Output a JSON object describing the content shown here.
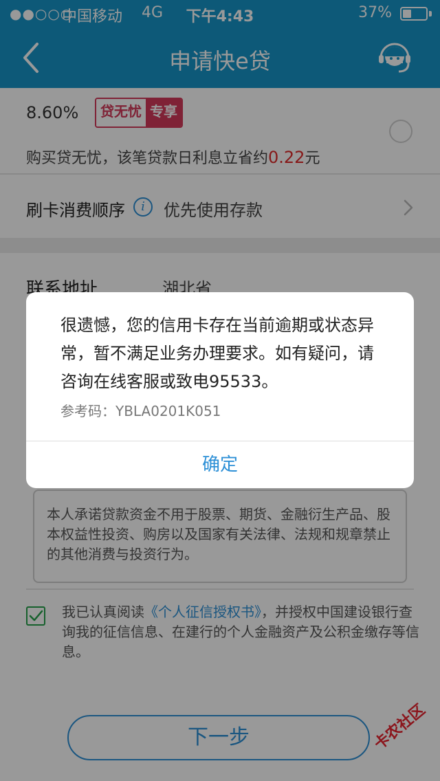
{
  "status_bar": {
    "signal": "●●○○○",
    "carrier": "中国移动",
    "network": "4G",
    "time": "下午4:43",
    "battery_percent": "37%",
    "battery_level": 0.37
  },
  "nav": {
    "title": "申请快e贷",
    "back_icon": "chevron-left-icon",
    "service_icon": "customer-service-icon"
  },
  "rate_option": {
    "rate": "8.60%",
    "badge_left": "贷无忧",
    "badge_right": "专享",
    "discount_prefix": "购买贷无忧，该笔贷款日利息立省约",
    "discount_amount": "0.22",
    "discount_suffix": "元"
  },
  "card_order": {
    "label": "刷卡消费顺序",
    "value": "优先使用存款"
  },
  "address": {
    "label": "联系地址",
    "value": "湖北省"
  },
  "commitment": "本人承诺贷款资金不用于股票、期货、金融衍生产品、股本权益性投资、购房以及国家有关法律、法规和规章禁止的其他消费与投资行为。",
  "agreement": {
    "prefix": "我已认真阅读",
    "link": "《个人征信授权书》",
    "suffix": "，并授权中国建设银行查询我的征信信息、在建行的个人金融资产及公积金缴存等信息。",
    "checked": true
  },
  "next_button": "下一步",
  "watermark": "卡农社区",
  "dialog": {
    "message": "很遗憾，您的信用卡存在当前逾期或状态异常，暂不满足业务办理要求。如有疑问，请咨询在线客服或致电95533。",
    "ref_code": "参考码：YBLA0201K051",
    "ok_button": "确定"
  },
  "colors": {
    "primary": "#1795c8",
    "link": "#2c8fd6",
    "badge": "#d43a5a",
    "highlight": "#e02a2a",
    "check": "#26a04a"
  }
}
